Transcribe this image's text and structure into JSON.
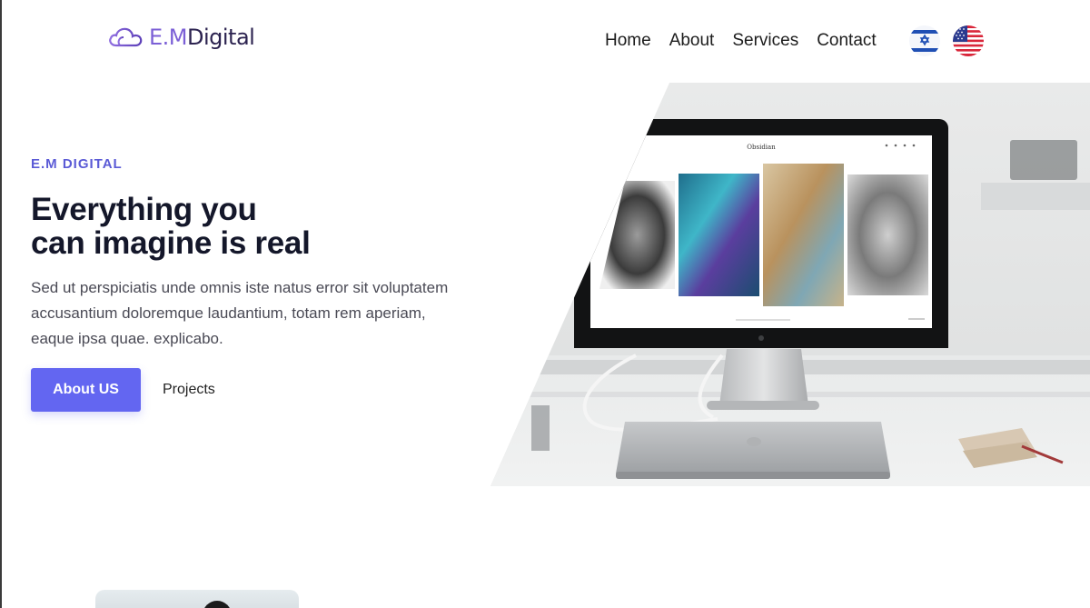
{
  "header": {
    "logo": {
      "prefix": "E.M",
      "suffix": "Digital",
      "icon": "cloud-icon"
    },
    "nav": [
      {
        "label": "Home"
      },
      {
        "label": "About"
      },
      {
        "label": "Services"
      },
      {
        "label": "Contact"
      }
    ],
    "languages": [
      {
        "icon": "israel-flag-icon"
      },
      {
        "icon": "us-flag-icon"
      }
    ]
  },
  "hero": {
    "eyebrow": "E.M DIGITAL",
    "headline_line1": "Everything you",
    "headline_line2": "can imagine is real",
    "description": "Sed ut perspiciatis unde omnis iste natus error sit voluptatem accusantium doloremque laudantium, totam rem aperiam, eaque ipsa quae. explicabo.",
    "primary_button": "About US",
    "secondary_link": "Projects",
    "image": {
      "screen_title": "Obsidian"
    }
  },
  "colors": {
    "accent": "#6366f1",
    "eyebrow": "#5b5bd6",
    "logo_purple": "#7b5fd6",
    "heading": "#14172a"
  }
}
